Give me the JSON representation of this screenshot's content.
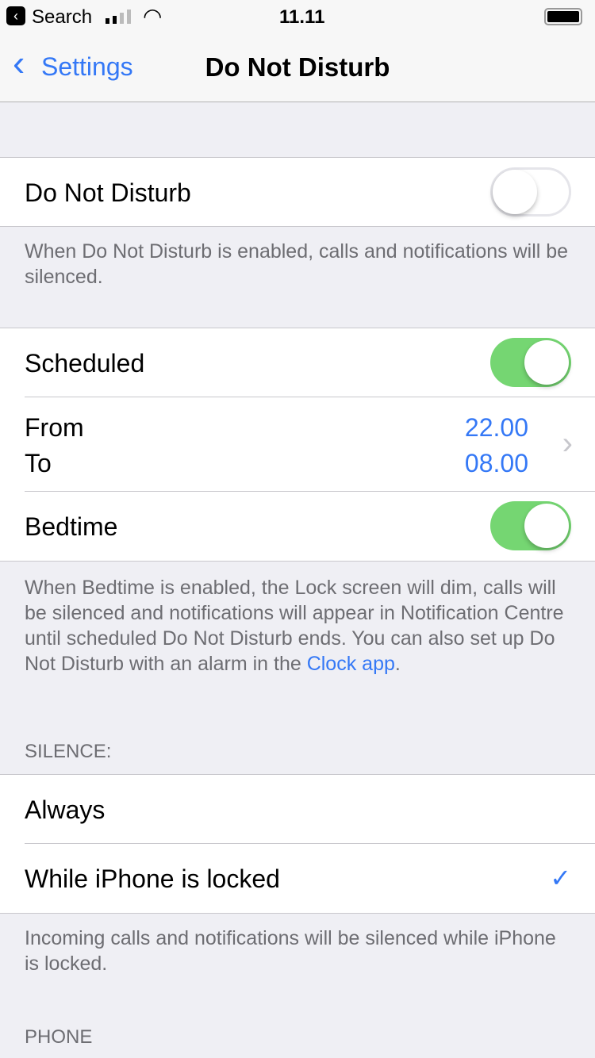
{
  "status_bar": {
    "back_app": "Search",
    "time": "11.11"
  },
  "nav": {
    "back_label": "Settings",
    "title": "Do Not Disturb"
  },
  "dnd": {
    "label": "Do Not Disturb",
    "enabled": false,
    "footer": "When Do Not Disturb is enabled, calls and notifications will be silenced."
  },
  "schedule": {
    "scheduled_label": "Scheduled",
    "scheduled_enabled": true,
    "from_label": "From",
    "from_value": "22.00",
    "to_label": "To",
    "to_value": "08.00",
    "bedtime_label": "Bedtime",
    "bedtime_enabled": true,
    "footer": "When Bedtime is enabled, the Lock screen will dim, calls will be silenced and notifications will appear in Notification Centre until scheduled Do Not Disturb ends. You can also set up Do Not Disturb with an alarm in the ",
    "footer_link": "Clock app",
    "footer_end": "."
  },
  "silence": {
    "header": "SILENCE:",
    "options": [
      {
        "label": "Always",
        "selected": false
      },
      {
        "label": "While iPhone is locked",
        "selected": true
      }
    ],
    "footer": "Incoming calls and notifications will be silenced while iPhone is locked."
  },
  "phone": {
    "header": "PHONE"
  },
  "colors": {
    "accent": "#3478f6",
    "toggle_on": "#75d672"
  }
}
